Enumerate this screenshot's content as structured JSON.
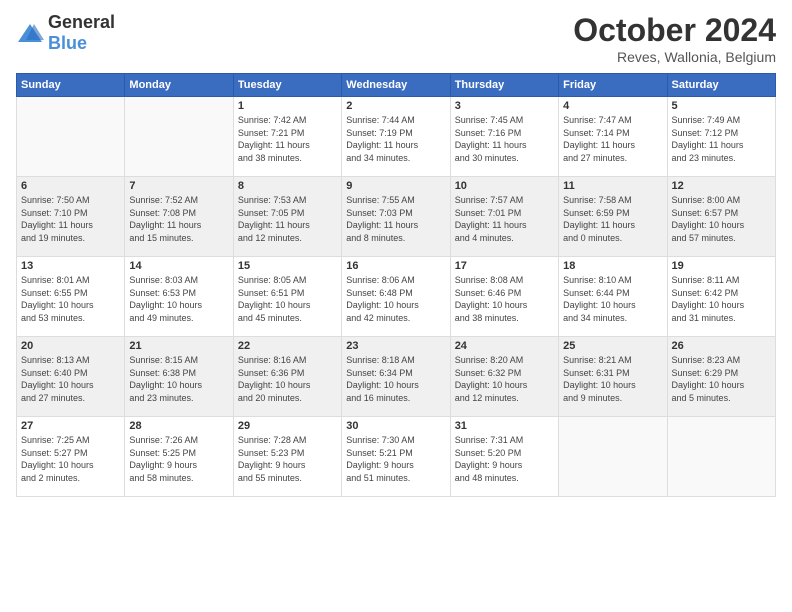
{
  "logo": {
    "general": "General",
    "blue": "Blue"
  },
  "header": {
    "month": "October 2024",
    "location": "Reves, Wallonia, Belgium"
  },
  "weekdays": [
    "Sunday",
    "Monday",
    "Tuesday",
    "Wednesday",
    "Thursday",
    "Friday",
    "Saturday"
  ],
  "weeks": [
    [
      {
        "day": "",
        "info": ""
      },
      {
        "day": "",
        "info": ""
      },
      {
        "day": "1",
        "info": "Sunrise: 7:42 AM\nSunset: 7:21 PM\nDaylight: 11 hours\nand 38 minutes."
      },
      {
        "day": "2",
        "info": "Sunrise: 7:44 AM\nSunset: 7:19 PM\nDaylight: 11 hours\nand 34 minutes."
      },
      {
        "day": "3",
        "info": "Sunrise: 7:45 AM\nSunset: 7:16 PM\nDaylight: 11 hours\nand 30 minutes."
      },
      {
        "day": "4",
        "info": "Sunrise: 7:47 AM\nSunset: 7:14 PM\nDaylight: 11 hours\nand 27 minutes."
      },
      {
        "day": "5",
        "info": "Sunrise: 7:49 AM\nSunset: 7:12 PM\nDaylight: 11 hours\nand 23 minutes."
      }
    ],
    [
      {
        "day": "6",
        "info": "Sunrise: 7:50 AM\nSunset: 7:10 PM\nDaylight: 11 hours\nand 19 minutes."
      },
      {
        "day": "7",
        "info": "Sunrise: 7:52 AM\nSunset: 7:08 PM\nDaylight: 11 hours\nand 15 minutes."
      },
      {
        "day": "8",
        "info": "Sunrise: 7:53 AM\nSunset: 7:05 PM\nDaylight: 11 hours\nand 12 minutes."
      },
      {
        "day": "9",
        "info": "Sunrise: 7:55 AM\nSunset: 7:03 PM\nDaylight: 11 hours\nand 8 minutes."
      },
      {
        "day": "10",
        "info": "Sunrise: 7:57 AM\nSunset: 7:01 PM\nDaylight: 11 hours\nand 4 minutes."
      },
      {
        "day": "11",
        "info": "Sunrise: 7:58 AM\nSunset: 6:59 PM\nDaylight: 11 hours\nand 0 minutes."
      },
      {
        "day": "12",
        "info": "Sunrise: 8:00 AM\nSunset: 6:57 PM\nDaylight: 10 hours\nand 57 minutes."
      }
    ],
    [
      {
        "day": "13",
        "info": "Sunrise: 8:01 AM\nSunset: 6:55 PM\nDaylight: 10 hours\nand 53 minutes."
      },
      {
        "day": "14",
        "info": "Sunrise: 8:03 AM\nSunset: 6:53 PM\nDaylight: 10 hours\nand 49 minutes."
      },
      {
        "day": "15",
        "info": "Sunrise: 8:05 AM\nSunset: 6:51 PM\nDaylight: 10 hours\nand 45 minutes."
      },
      {
        "day": "16",
        "info": "Sunrise: 8:06 AM\nSunset: 6:48 PM\nDaylight: 10 hours\nand 42 minutes."
      },
      {
        "day": "17",
        "info": "Sunrise: 8:08 AM\nSunset: 6:46 PM\nDaylight: 10 hours\nand 38 minutes."
      },
      {
        "day": "18",
        "info": "Sunrise: 8:10 AM\nSunset: 6:44 PM\nDaylight: 10 hours\nand 34 minutes."
      },
      {
        "day": "19",
        "info": "Sunrise: 8:11 AM\nSunset: 6:42 PM\nDaylight: 10 hours\nand 31 minutes."
      }
    ],
    [
      {
        "day": "20",
        "info": "Sunrise: 8:13 AM\nSunset: 6:40 PM\nDaylight: 10 hours\nand 27 minutes."
      },
      {
        "day": "21",
        "info": "Sunrise: 8:15 AM\nSunset: 6:38 PM\nDaylight: 10 hours\nand 23 minutes."
      },
      {
        "day": "22",
        "info": "Sunrise: 8:16 AM\nSunset: 6:36 PM\nDaylight: 10 hours\nand 20 minutes."
      },
      {
        "day": "23",
        "info": "Sunrise: 8:18 AM\nSunset: 6:34 PM\nDaylight: 10 hours\nand 16 minutes."
      },
      {
        "day": "24",
        "info": "Sunrise: 8:20 AM\nSunset: 6:32 PM\nDaylight: 10 hours\nand 12 minutes."
      },
      {
        "day": "25",
        "info": "Sunrise: 8:21 AM\nSunset: 6:31 PM\nDaylight: 10 hours\nand 9 minutes."
      },
      {
        "day": "26",
        "info": "Sunrise: 8:23 AM\nSunset: 6:29 PM\nDaylight: 10 hours\nand 5 minutes."
      }
    ],
    [
      {
        "day": "27",
        "info": "Sunrise: 7:25 AM\nSunset: 5:27 PM\nDaylight: 10 hours\nand 2 minutes."
      },
      {
        "day": "28",
        "info": "Sunrise: 7:26 AM\nSunset: 5:25 PM\nDaylight: 9 hours\nand 58 minutes."
      },
      {
        "day": "29",
        "info": "Sunrise: 7:28 AM\nSunset: 5:23 PM\nDaylight: 9 hours\nand 55 minutes."
      },
      {
        "day": "30",
        "info": "Sunrise: 7:30 AM\nSunset: 5:21 PM\nDaylight: 9 hours\nand 51 minutes."
      },
      {
        "day": "31",
        "info": "Sunrise: 7:31 AM\nSunset: 5:20 PM\nDaylight: 9 hours\nand 48 minutes."
      },
      {
        "day": "",
        "info": ""
      },
      {
        "day": "",
        "info": ""
      }
    ]
  ]
}
